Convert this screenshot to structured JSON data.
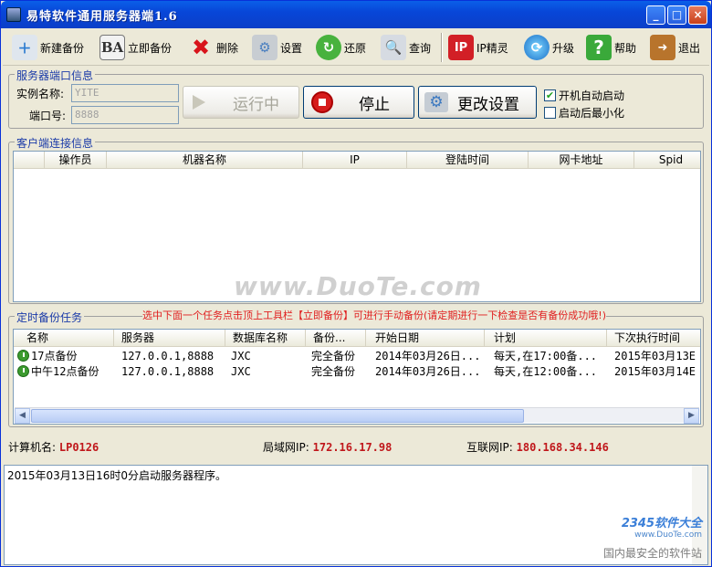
{
  "window": {
    "title": "易特软件通用服务器端1.6",
    "minimize": "_",
    "maximize": "□",
    "close": "×"
  },
  "toolbar": [
    {
      "label": "新建备份",
      "icon": "new-backup-icon"
    },
    {
      "label": "立即备份",
      "icon": "backup-now-icon"
    },
    {
      "label": "删除",
      "icon": "delete-icon"
    },
    {
      "label": "设置",
      "icon": "settings-icon"
    },
    {
      "label": "还原",
      "icon": "restore-icon"
    },
    {
      "label": "查询",
      "icon": "query-icon"
    },
    {
      "label": "IP精灵",
      "icon": "ip-sprite-icon"
    },
    {
      "label": "升级",
      "icon": "upgrade-icon"
    },
    {
      "label": "帮助",
      "icon": "help-icon"
    },
    {
      "label": "退出",
      "icon": "exit-icon"
    }
  ],
  "server": {
    "legend": "服务器端口信息",
    "instance_label": "实例名称:",
    "instance_value": "YITE",
    "port_label": "端口号:",
    "port_value": "8888",
    "running_label": "运行中",
    "stop_label": "停止",
    "change_label": "更改设置",
    "autostart_label": "开机自动启动",
    "autostart_checked": true,
    "minimize_label": "启动后最小化",
    "minimize_checked": false
  },
  "clients": {
    "legend": "客户端连接信息",
    "columns": [
      "",
      "操作员",
      "机器名称",
      "IP",
      "登陆时间",
      "网卡地址",
      "Spid"
    ]
  },
  "tasks": {
    "legend": "定时备份任务",
    "notice": "选中下面一个任务点击顶上工具栏【立即备份】可进行手动备份(请定期进行一下检查是否有备份成功哦!)",
    "columns": [
      "名称",
      "服务器",
      "数据库名称",
      "备份...",
      "开始日期",
      "计划",
      "下次执行时间"
    ],
    "rows": [
      [
        "17点备份",
        "127.0.0.1,8888",
        "JXC",
        "完全备份",
        "2014年03月26日...",
        "每天,在17:00备...",
        "2015年03月13E"
      ],
      [
        "中午12点备份",
        "127.0.0.1,8888",
        "JXC",
        "完全备份",
        "2014年03月26日...",
        "每天,在12:00备...",
        "2015年03月14E"
      ]
    ]
  },
  "status": {
    "computer_label": "计算机名:",
    "computer_value": "LP0126",
    "lan_label": "局域网IP:",
    "lan_value": "172.16.17.98",
    "wan_label": "互联网IP:",
    "wan_value": "180.168.34.146"
  },
  "log": {
    "line": "2015年03月13日16时0分启动服务器程序。"
  },
  "watermarks": {
    "duote": "www.DuoTe.com",
    "brand": "2345软件大全",
    "site": "www.DuoTe.com",
    "slogan": "国内最安全的软件站"
  },
  "colors": {
    "title_bar": "#0846d8",
    "legend": "#1a3aa8",
    "status_value": "#c0171b",
    "notice": "#e02020"
  }
}
